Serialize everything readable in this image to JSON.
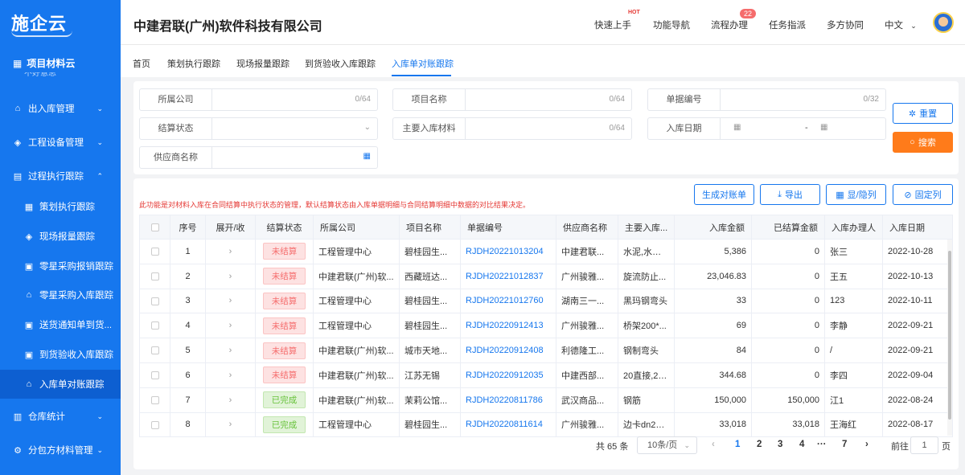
{
  "app": {
    "logo_text": "施企云",
    "company": "中建君联(广州)软件科技有限公司"
  },
  "sidebar": {
    "section_title": "项目材料云",
    "clipped_item": "不好意思",
    "items": [
      {
        "label": "出入库管理",
        "icon": "shield-icon",
        "chev": "⌄"
      },
      {
        "label": "工程设备管理",
        "icon": "cube-icon",
        "chev": "⌄"
      },
      {
        "label": "过程执行跟踪",
        "icon": "list-icon",
        "chev": "⌃"
      },
      {
        "label": "策划执行跟踪",
        "icon": "grid-icon"
      },
      {
        "label": "现场报量跟踪",
        "icon": "cube-icon"
      },
      {
        "label": "零星采购报销跟踪",
        "icon": "doc-icon"
      },
      {
        "label": "零星采购入库跟踪",
        "icon": "home-icon"
      },
      {
        "label": "送货通知单到货...",
        "icon": "box-icon"
      },
      {
        "label": "到货验收入库跟踪",
        "icon": "check-icon"
      },
      {
        "label": "入库单对账跟踪",
        "icon": "home-icon"
      },
      {
        "label": "仓库统计",
        "icon": "chart-icon",
        "chev": "⌄"
      },
      {
        "label": "分包方材料管理",
        "icon": "gear-icon",
        "chev": "⌄"
      }
    ]
  },
  "header": {
    "links": [
      "快速上手",
      "功能导航",
      "流程办理",
      "任务指派",
      "多方协同",
      "中文"
    ],
    "hot_label": "HOT",
    "badge_count": "22"
  },
  "tabs": [
    "首页",
    "策划执行跟踪",
    "现场报量跟踪",
    "到货验收入库跟踪",
    "入库单对账跟踪"
  ],
  "filters": {
    "company_label": "所属公司",
    "company_count": "0/64",
    "project_label": "项目名称",
    "project_count": "0/64",
    "bill_no_label": "单据编号",
    "bill_no_count": "0/32",
    "status_label": "结算状态",
    "material_label": "主要入库材料",
    "material_count": "0/64",
    "date_label": "入库日期",
    "date_sep": "-",
    "supplier_label": "供应商名称",
    "reset_label": "重置",
    "search_label": "搜索"
  },
  "actions": {
    "generate": "生成对账单",
    "export": "导出",
    "toggle_cols": "显/隐列",
    "fix_cols": "固定列"
  },
  "notice": "此功能是对材料入库在合同结算中执行状态的管理，默认结算状态由入库单据明细与合同结算明细中数据的对比结果决定。",
  "table": {
    "headers": [
      "序号",
      "展开/收",
      "结算状态",
      "所属公司",
      "项目名称",
      "单据编号",
      "供应商名称",
      "主要入库...",
      "入库金额",
      "已结算金额",
      "入库办理人",
      "入库日期"
    ],
    "rows": [
      {
        "no": "1",
        "status": "未结算",
        "st": "red",
        "company": "工程管理中心",
        "project": "碧桂园生...",
        "bill": "RJDH20221013204",
        "supplier": "中建君联...",
        "material": "水泥,水泥,...",
        "amount": "5,386",
        "settled": "0",
        "handler": "张三",
        "date": "2022-10-28"
      },
      {
        "no": "2",
        "status": "未结算",
        "st": "red",
        "company": "中建君联(广州)软...",
        "project": "西藏班达...",
        "bill": "RJDH20221012837",
        "supplier": "广州骏雅...",
        "material": "旋流防止...",
        "amount": "23,046.83",
        "settled": "0",
        "handler": "王五",
        "date": "2022-10-13"
      },
      {
        "no": "3",
        "status": "未结算",
        "st": "red",
        "company": "工程管理中心",
        "project": "碧桂园生...",
        "bill": "RJDH20221012760",
        "supplier": "湖南三一...",
        "material": "黑玛钢弯头",
        "amount": "33",
        "settled": "0",
        "handler": "123",
        "date": "2022-10-11"
      },
      {
        "no": "4",
        "status": "未结算",
        "st": "red",
        "company": "工程管理中心",
        "project": "碧桂园生...",
        "bill": "RJDH20220912413",
        "supplier": "广州骏雅...",
        "material": "桥架200*...",
        "amount": "69",
        "settled": "0",
        "handler": "李静",
        "date": "2022-09-21"
      },
      {
        "no": "5",
        "status": "未结算",
        "st": "red",
        "company": "中建君联(广州)软...",
        "project": "城市天地...",
        "bill": "RJDH20220912408",
        "supplier": "利德隆工...",
        "material": "钢制弯头",
        "amount": "84",
        "settled": "0",
        "handler": "/",
        "date": "2022-09-21"
      },
      {
        "no": "6",
        "status": "未结算",
        "st": "red",
        "company": "中建君联(广州)软...",
        "project": "江苏无锡",
        "bill": "RJDH20220912035",
        "supplier": "中建西部...",
        "material": "20直接,25...",
        "amount": "344.68",
        "settled": "0",
        "handler": "李四",
        "date": "2022-09-04"
      },
      {
        "no": "7",
        "status": "已完成",
        "st": "green",
        "company": "中建君联(广州)软...",
        "project": "茉莉公馆...",
        "bill": "RJDH20220811786",
        "supplier": "武汉商品...",
        "material": "钢筋",
        "amount": "150,000",
        "settled": "150,000",
        "handler": "江1",
        "date": "2022-08-24"
      },
      {
        "no": "8",
        "status": "已完成",
        "st": "green",
        "company": "工程管理中心",
        "project": "碧桂园生...",
        "bill": "RJDH20220811614",
        "supplier": "广州骏雅...",
        "material": "边卡dn20,...",
        "amount": "33,018",
        "settled": "33,018",
        "handler": "王海红",
        "date": "2022-08-17"
      }
    ]
  },
  "pagination": {
    "total": "共 65 条",
    "page_size": "10条/页",
    "pages": [
      "1",
      "2",
      "3",
      "4",
      "···",
      "7"
    ],
    "goto_prefix": "前往",
    "goto_value": "1",
    "goto_suffix": "页"
  }
}
